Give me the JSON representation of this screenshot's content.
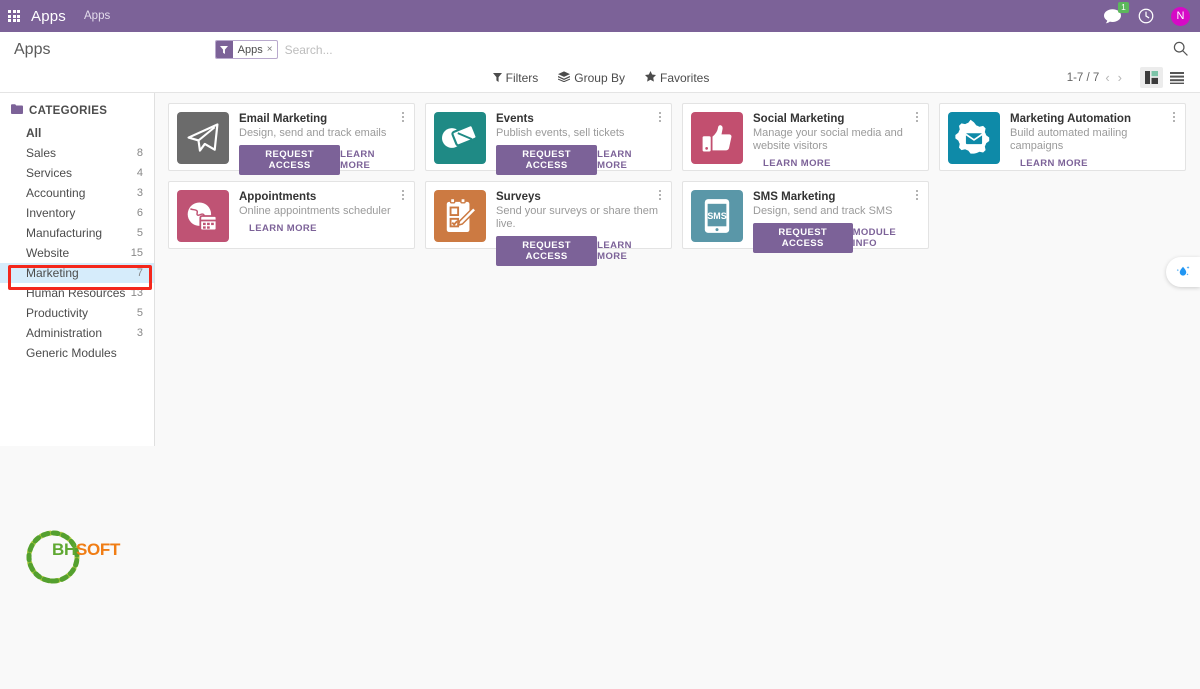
{
  "navbar": {
    "apps_grid_icon": "apps-grid-icon",
    "brand": "Apps",
    "menu": "Apps",
    "messages_icon": "chat-icon",
    "messages_badge": "1",
    "activity_icon": "clock-icon",
    "avatar_initial": "N",
    "bg_color": "#7c6298",
    "badge_color": "#5cb85c",
    "avatar_color": "#d60ac6"
  },
  "control_panel": {
    "title": "Apps",
    "facet": {
      "icon": "filter-funnel-icon",
      "label": "Apps",
      "remove": "×"
    },
    "search": {
      "value": "",
      "placeholder": "Search..."
    },
    "search_icon": "search-icon",
    "buttons": [
      {
        "label": "Filters",
        "icon": "filter-funnel-icon"
      },
      {
        "label": "Group By",
        "icon": "layers-icon"
      },
      {
        "label": "Favorites",
        "icon": "star-icon"
      }
    ],
    "pager": "1-7 / 7",
    "prev_icon": "chevron-left-icon",
    "next_icon": "chevron-right-icon",
    "views": [
      {
        "name": "kanban",
        "icon": "kanban-view-icon",
        "active": true
      },
      {
        "name": "list",
        "icon": "list-view-icon",
        "active": false
      }
    ]
  },
  "sidebar": {
    "header": "CATEGORIES",
    "header_icon": "folder-icon",
    "items": [
      {
        "label": "All",
        "count": "",
        "bold": true,
        "selected": false
      },
      {
        "label": "Sales",
        "count": "8",
        "bold": false,
        "selected": false
      },
      {
        "label": "Services",
        "count": "4",
        "bold": false,
        "selected": false
      },
      {
        "label": "Accounting",
        "count": "3",
        "bold": false,
        "selected": false
      },
      {
        "label": "Inventory",
        "count": "6",
        "bold": false,
        "selected": false
      },
      {
        "label": "Manufacturing",
        "count": "5",
        "bold": false,
        "selected": false
      },
      {
        "label": "Website",
        "count": "15",
        "bold": false,
        "selected": false
      },
      {
        "label": "Marketing",
        "count": "7",
        "bold": false,
        "selected": true
      },
      {
        "label": "Human Resources",
        "count": "13",
        "bold": false,
        "selected": false
      },
      {
        "label": "Productivity",
        "count": "5",
        "bold": false,
        "selected": false
      },
      {
        "label": "Administration",
        "count": "3",
        "bold": false,
        "selected": false
      },
      {
        "label": "Generic Modules",
        "count": "",
        "bold": false,
        "selected": false
      }
    ]
  },
  "apps": [
    {
      "name": "Email Marketing",
      "description": "Design, send and track emails",
      "icon": "paper-plane-icon",
      "icon_bg": "#6b6b6b",
      "primary_action": "REQUEST ACCESS",
      "secondary_action": "LEARN MORE"
    },
    {
      "name": "Events",
      "description": "Publish events, sell tickets",
      "icon": "tickets-icon",
      "icon_bg": "#1f8a85",
      "primary_action": "REQUEST ACCESS",
      "secondary_action": "LEARN MORE"
    },
    {
      "name": "Social Marketing",
      "description": "Manage your social media and website visitors",
      "icon": "thumbs-up-icon",
      "icon_bg": "#c24f6f",
      "primary_action": "",
      "secondary_action": "LEARN MORE"
    },
    {
      "name": "Marketing Automation",
      "description": "Build automated mailing campaigns",
      "icon": "gear-envelope-icon",
      "icon_bg": "#0e8aa8",
      "primary_action": "",
      "secondary_action": "LEARN MORE"
    },
    {
      "name": "Appointments",
      "description": "Online appointments scheduler",
      "icon": "globe-calendar-icon",
      "icon_bg": "#bf5374",
      "primary_action": "",
      "secondary_action": "LEARN MORE"
    },
    {
      "name": "Surveys",
      "description": "Send your surveys or share them live.",
      "icon": "clipboard-pencil-icon",
      "icon_bg": "#cc7a42",
      "primary_action": "REQUEST ACCESS",
      "secondary_action": "LEARN MORE"
    },
    {
      "name": "SMS Marketing",
      "description": "Design, send and track SMS",
      "icon": "sms-phone-icon",
      "icon_bg": "#5a97a8",
      "primary_action": "REQUEST ACCESS",
      "secondary_action": "MODULE INFO"
    }
  ],
  "floating_widget": {
    "icon": "water-drop-sparkle-icon"
  },
  "logo": {
    "part1": "BH",
    "part2": "SOFT",
    "icon": "bhsoft-circle-logo"
  },
  "annotation": {
    "target": "Marketing",
    "color": "#f4271c"
  }
}
